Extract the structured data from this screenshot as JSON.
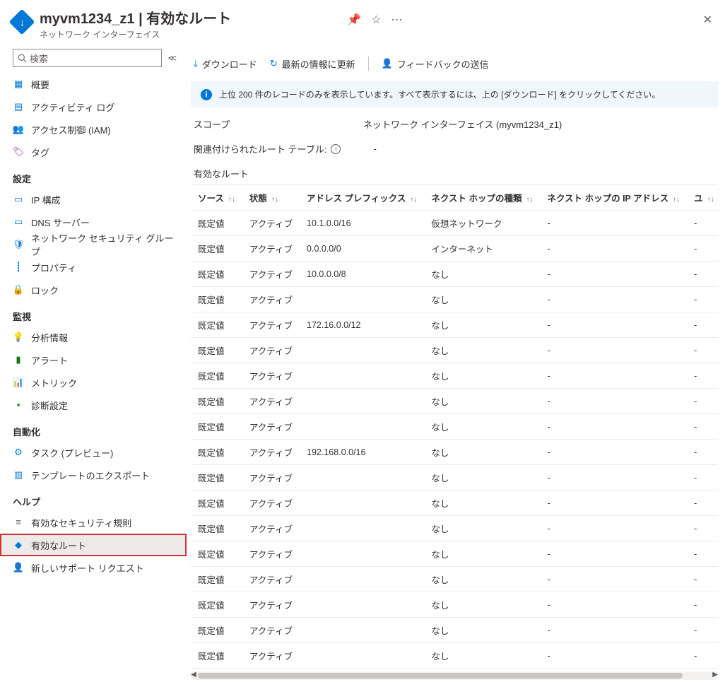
{
  "header": {
    "title": "myvm1234_z1 | 有効なルート",
    "subtitle": "ネットワーク インターフェイス"
  },
  "search": {
    "placeholder": "検索"
  },
  "sidebar": {
    "top": [
      {
        "icon": "overview",
        "label": "概要"
      },
      {
        "icon": "log",
        "label": "アクティビティ ログ"
      },
      {
        "icon": "iam",
        "label": "アクセス制御 (IAM)"
      },
      {
        "icon": "tag",
        "label": "タグ"
      }
    ],
    "groups": [
      {
        "title": "設定",
        "items": [
          {
            "icon": "ipconfig",
            "label": "IP 構成"
          },
          {
            "icon": "dns",
            "label": "DNS サーバー"
          },
          {
            "icon": "nsg",
            "label": "ネットワーク セキュリティ グループ"
          },
          {
            "icon": "props",
            "label": "プロパティ"
          },
          {
            "icon": "lock",
            "label": "ロック"
          }
        ]
      },
      {
        "title": "監視",
        "items": [
          {
            "icon": "insights",
            "label": "分析情報"
          },
          {
            "icon": "alerts",
            "label": "アラート"
          },
          {
            "icon": "metrics",
            "label": "メトリック"
          },
          {
            "icon": "diag",
            "label": "診断設定"
          }
        ]
      },
      {
        "title": "自動化",
        "items": [
          {
            "icon": "tasks",
            "label": "タスク (プレビュー)"
          },
          {
            "icon": "export",
            "label": "テンプレートのエクスポート"
          }
        ]
      },
      {
        "title": "ヘルプ",
        "items": [
          {
            "icon": "secrules",
            "label": "有効なセキュリティ規則"
          },
          {
            "icon": "routes",
            "label": "有効なルート",
            "selected": true,
            "highlighted": true
          },
          {
            "icon": "support",
            "label": "新しいサポート リクエスト"
          }
        ]
      }
    ]
  },
  "toolbar": {
    "download": "ダウンロード",
    "refresh": "最新の情報に更新",
    "feedback": "フィードバックの送信"
  },
  "info_bar": "上位 200 件のレコードのみを表示しています。すべて表示するには、上の [ダウンロード] をクリックしてください。",
  "scope": {
    "label": "スコープ",
    "value": "ネットワーク インターフェイス (myvm1234_z1)"
  },
  "associated": {
    "label": "関連付けられたルート テーブル:",
    "value": "-"
  },
  "section_title": "有効なルート",
  "columns": [
    "ソース",
    "状態",
    "アドレス プレフィックス",
    "ネクスト ホップの種類",
    "ネクスト ホップの IP アドレス",
    "ユ"
  ],
  "rows": [
    {
      "source": "既定値",
      "state": "アクティブ",
      "prefix": "10.1.0.0/16",
      "nht": "仮想ネットワーク",
      "nhip": "-",
      "u": "-"
    },
    {
      "source": "既定値",
      "state": "アクティブ",
      "prefix": "0.0.0.0/0",
      "nht": "インターネット",
      "nhip": "-",
      "u": "-"
    },
    {
      "source": "既定値",
      "state": "アクティブ",
      "prefix": "10.0.0.0/8",
      "nht": "なし",
      "nhip": "-",
      "u": "-"
    },
    {
      "source": "既定値",
      "state": "アクティブ",
      "prefix": "",
      "nht": "なし",
      "nhip": "-",
      "u": "-"
    },
    {
      "source": "既定値",
      "state": "アクティブ",
      "prefix": "172.16.0.0/12",
      "nht": "なし",
      "nhip": "-",
      "u": "-"
    },
    {
      "source": "既定値",
      "state": "アクティブ",
      "prefix": "",
      "nht": "なし",
      "nhip": "-",
      "u": "-"
    },
    {
      "source": "既定値",
      "state": "アクティブ",
      "prefix": "",
      "nht": "なし",
      "nhip": "-",
      "u": "-"
    },
    {
      "source": "既定値",
      "state": "アクティブ",
      "prefix": "",
      "nht": "なし",
      "nhip": "-",
      "u": "-"
    },
    {
      "source": "既定値",
      "state": "アクティブ",
      "prefix": "",
      "nht": "なし",
      "nhip": "-",
      "u": "-"
    },
    {
      "source": "既定値",
      "state": "アクティブ",
      "prefix": "192.168.0.0/16",
      "nht": "なし",
      "nhip": "-",
      "u": "-"
    },
    {
      "source": "既定値",
      "state": "アクティブ",
      "prefix": "",
      "nht": "なし",
      "nhip": "-",
      "u": "-"
    },
    {
      "source": "既定値",
      "state": "アクティブ",
      "prefix": "",
      "nht": "なし",
      "nhip": "-",
      "u": "-"
    },
    {
      "source": "既定値",
      "state": "アクティブ",
      "prefix": "",
      "nht": "なし",
      "nhip": "-",
      "u": "-"
    },
    {
      "source": "既定値",
      "state": "アクティブ",
      "prefix": "",
      "nht": "なし",
      "nhip": "-",
      "u": "-"
    },
    {
      "source": "既定値",
      "state": "アクティブ",
      "prefix": "",
      "nht": "なし",
      "nhip": "-",
      "u": "-"
    },
    {
      "source": "既定値",
      "state": "アクティブ",
      "prefix": "",
      "nht": "なし",
      "nhip": "-",
      "u": "-"
    },
    {
      "source": "既定値",
      "state": "アクティブ",
      "prefix": "",
      "nht": "なし",
      "nhip": "-",
      "u": "-"
    },
    {
      "source": "既定値",
      "state": "アクティブ",
      "prefix": "",
      "nht": "なし",
      "nhip": "-",
      "u": "-"
    }
  ]
}
